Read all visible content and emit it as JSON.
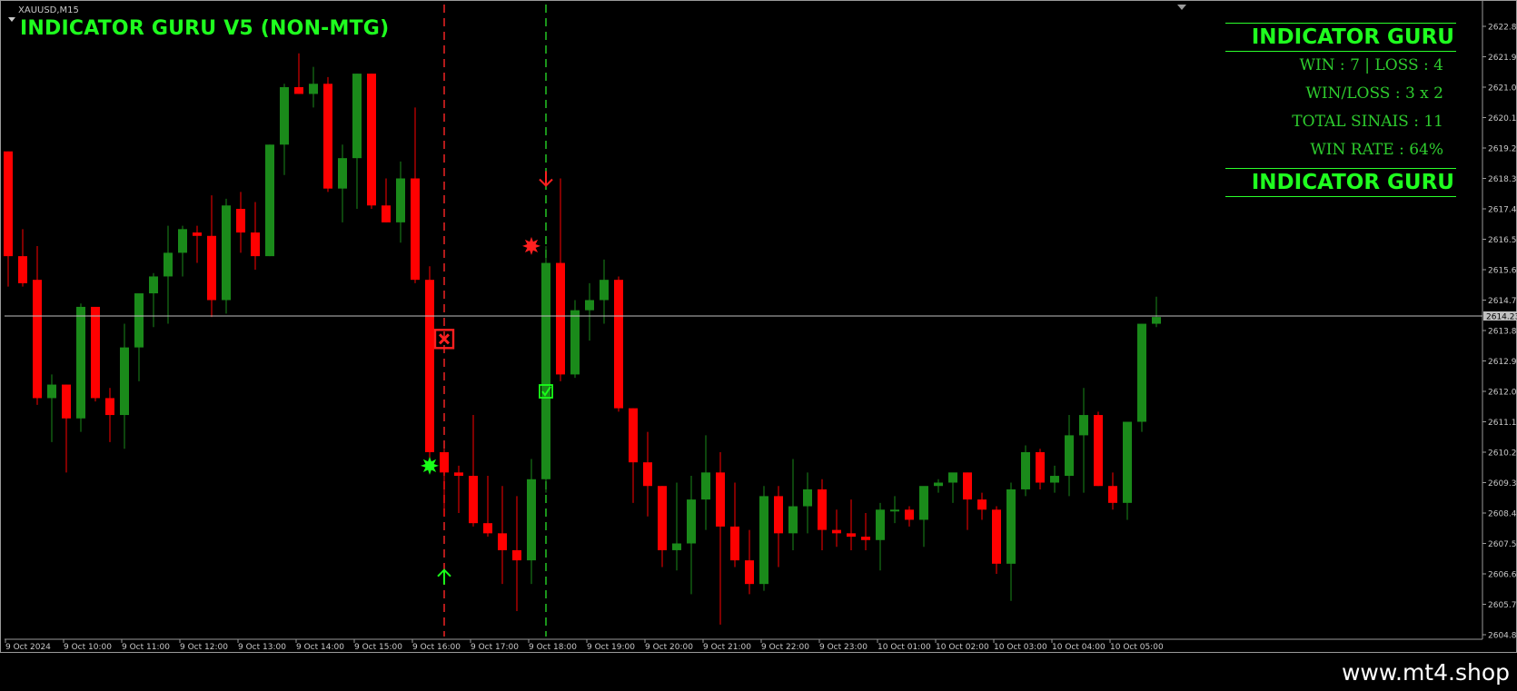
{
  "window": {
    "symbol_label": "XAUUSD,M15",
    "indicator_title": "INDICATOR GURU V5 (NON-MTG)"
  },
  "stats_panel": {
    "header_top": "INDICATOR GURU",
    "win_loss": "WIN : 7 | LOSS : 4",
    "win_loss_ratio": "WIN/LOSS : 3 x 2",
    "total_signals": "TOTAL SINAIS : 11",
    "win_rate": "WIN RATE : 64%",
    "header_bottom": "INDICATOR GURU"
  },
  "branding": {
    "site": "www.mt4.shop"
  },
  "colors": {
    "bull": "#1a8a1a",
    "bear": "#ff0000",
    "text_green": "#1fff1f",
    "axis_text": "#c8c8c8",
    "price_line": "#c0c0c0"
  },
  "chart_data": {
    "type": "candlestick",
    "title": "",
    "ylim": [
      2604.8,
      2622.8
    ],
    "y_ticks": [
      "2622.80",
      "2621.90",
      "2621.00",
      "2620.10",
      "2619.20",
      "2618.30",
      "2617.40",
      "2616.50",
      "2615.60",
      "2614.70",
      "2613.80",
      "2612.90",
      "2612.00",
      "2611.10",
      "2610.20",
      "2609.30",
      "2608.40",
      "2607.50",
      "2606.60",
      "2605.70",
      "2604.80"
    ],
    "x_labels": [
      "9 Oct 2024",
      "9 Oct 10:00",
      "9 Oct 11:00",
      "9 Oct 12:00",
      "9 Oct 13:00",
      "9 Oct 14:00",
      "9 Oct 15:00",
      "9 Oct 16:00",
      "9 Oct 17:00",
      "9 Oct 18:00",
      "9 Oct 19:00",
      "9 Oct 20:00",
      "9 Oct 21:00",
      "9 Oct 22:00",
      "9 Oct 23:00",
      "10 Oct 01:00",
      "10 Oct 02:00",
      "10 Oct 03:00",
      "10 Oct 04:00",
      "10 Oct 05:00"
    ],
    "current_price": 2614.23,
    "current_price_label": "2614.23",
    "candles": [
      [
        2619.1,
        2619.1,
        2615.1,
        2616.0
      ],
      [
        2616.0,
        2616.8,
        2615.1,
        2615.2
      ],
      [
        2615.3,
        2616.3,
        2611.6,
        2611.8
      ],
      [
        2611.8,
        2612.5,
        2610.5,
        2612.2
      ],
      [
        2612.2,
        2612.2,
        2609.6,
        2611.2
      ],
      [
        2611.2,
        2614.6,
        2610.8,
        2614.5
      ],
      [
        2614.5,
        2614.5,
        2611.7,
        2611.8
      ],
      [
        2611.8,
        2612.1,
        2610.5,
        2611.3
      ],
      [
        2611.3,
        2614.0,
        2610.3,
        2613.3
      ],
      [
        2613.3,
        2614.8,
        2612.3,
        2614.9
      ],
      [
        2614.9,
        2615.5,
        2613.9,
        2615.4
      ],
      [
        2615.4,
        2616.9,
        2614.0,
        2616.1
      ],
      [
        2616.1,
        2616.9,
        2615.4,
        2616.8
      ],
      [
        2616.7,
        2616.9,
        2615.8,
        2616.6
      ],
      [
        2616.6,
        2617.8,
        2614.2,
        2614.7
      ],
      [
        2614.7,
        2617.7,
        2614.3,
        2617.5
      ],
      [
        2617.4,
        2617.9,
        2616.1,
        2616.7
      ],
      [
        2616.7,
        2617.6,
        2615.6,
        2616.0
      ],
      [
        2616.0,
        2619.3,
        2616.0,
        2619.3
      ],
      [
        2619.3,
        2621.1,
        2618.4,
        2621.0
      ],
      [
        2621.0,
        2622.0,
        2620.8,
        2620.8
      ],
      [
        2620.8,
        2621.6,
        2620.4,
        2621.1
      ],
      [
        2621.1,
        2621.3,
        2617.9,
        2618.0
      ],
      [
        2618.0,
        2619.3,
        2617.0,
        2618.9
      ],
      [
        2618.9,
        2621.4,
        2617.4,
        2621.4
      ],
      [
        2621.4,
        2621.4,
        2617.4,
        2617.5
      ],
      [
        2617.5,
        2618.3,
        2617.0,
        2617.0
      ],
      [
        2617.0,
        2618.8,
        2616.4,
        2618.3
      ],
      [
        2618.3,
        2620.4,
        2615.2,
        2615.3
      ],
      [
        2615.3,
        2615.7,
        2609.8,
        2610.2
      ],
      [
        2610.2,
        2610.3,
        2608.3,
        2609.6
      ],
      [
        2609.6,
        2609.8,
        2608.4,
        2609.5
      ],
      [
        2609.5,
        2611.3,
        2608.0,
        2608.1
      ],
      [
        2608.1,
        2609.5,
        2607.7,
        2607.8
      ],
      [
        2607.8,
        2609.2,
        2606.3,
        2607.3
      ],
      [
        2607.3,
        2608.9,
        2605.5,
        2607.0
      ],
      [
        2607.0,
        2610.0,
        2606.3,
        2609.4
      ],
      [
        2609.4,
        2616.3,
        2609.0,
        2615.8
      ],
      [
        2615.8,
        2618.3,
        2612.3,
        2612.5
      ],
      [
        2612.5,
        2614.7,
        2612.4,
        2614.4
      ],
      [
        2614.4,
        2615.2,
        2613.5,
        2614.7
      ],
      [
        2614.7,
        2615.9,
        2614.0,
        2615.3
      ],
      [
        2615.3,
        2615.4,
        2611.4,
        2611.5
      ],
      [
        2611.5,
        2611.5,
        2608.7,
        2609.9
      ],
      [
        2609.9,
        2610.8,
        2608.3,
        2609.2
      ],
      [
        2609.2,
        2609.2,
        2606.8,
        2607.3
      ],
      [
        2607.3,
        2609.3,
        2606.7,
        2607.5
      ],
      [
        2607.5,
        2609.5,
        2606.0,
        2608.8
      ],
      [
        2608.8,
        2610.7,
        2607.9,
        2609.6
      ],
      [
        2609.6,
        2610.2,
        2605.1,
        2608.0
      ],
      [
        2608.0,
        2609.3,
        2606.8,
        2607.0
      ],
      [
        2607.0,
        2607.9,
        2606.0,
        2606.3
      ],
      [
        2606.3,
        2609.2,
        2606.1,
        2608.9
      ],
      [
        2608.9,
        2609.2,
        2606.8,
        2607.8
      ],
      [
        2607.8,
        2610.0,
        2607.3,
        2608.6
      ],
      [
        2608.6,
        2609.6,
        2607.8,
        2609.1
      ],
      [
        2609.1,
        2609.4,
        2607.3,
        2607.9
      ],
      [
        2607.9,
        2608.5,
        2607.4,
        2607.8
      ],
      [
        2607.8,
        2608.8,
        2607.3,
        2607.7
      ],
      [
        2607.7,
        2608.4,
        2607.3,
        2607.6
      ],
      [
        2607.6,
        2608.7,
        2606.7,
        2608.5
      ],
      [
        2608.5,
        2608.9,
        2608.1,
        2608.5
      ],
      [
        2608.5,
        2608.6,
        2608.0,
        2608.2
      ],
      [
        2608.2,
        2608.9,
        2607.4,
        2609.2
      ],
      [
        2609.2,
        2609.4,
        2609.0,
        2609.3
      ],
      [
        2609.3,
        2609.5,
        2608.7,
        2609.6
      ],
      [
        2609.6,
        2609.6,
        2607.9,
        2608.8
      ],
      [
        2608.8,
        2609.0,
        2608.2,
        2608.5
      ],
      [
        2608.5,
        2608.6,
        2606.6,
        2606.9
      ],
      [
        2606.9,
        2609.3,
        2605.8,
        2609.1
      ],
      [
        2609.1,
        2610.4,
        2608.9,
        2610.2
      ],
      [
        2610.2,
        2610.3,
        2609.1,
        2609.3
      ],
      [
        2609.3,
        2609.8,
        2609.0,
        2609.5
      ],
      [
        2609.5,
        2611.3,
        2608.9,
        2610.7
      ],
      [
        2610.7,
        2612.1,
        2609.0,
        2611.3
      ],
      [
        2611.3,
        2611.4,
        2609.2,
        2609.2
      ],
      [
        2609.2,
        2609.6,
        2608.5,
        2608.7
      ],
      [
        2608.7,
        2611.0,
        2608.2,
        2611.1
      ],
      [
        2611.1,
        2614.0,
        2610.8,
        2614.0
      ],
      [
        2614.0,
        2614.8,
        2613.9,
        2614.2
      ]
    ],
    "vertical_markers": [
      {
        "candle": 30,
        "color": "#e02020"
      },
      {
        "candle": 37,
        "color": "#22b822"
      }
    ],
    "signals": [
      {
        "candle": 30,
        "type": "x-box",
        "price": 2613.55,
        "color": "#ff2020"
      },
      {
        "candle": 29,
        "type": "star",
        "price": 2609.8,
        "color": "#19ff19"
      },
      {
        "candle": 30,
        "type": "up-arrow",
        "price": 2606.5,
        "color": "#19ff19"
      },
      {
        "candle": 36,
        "type": "star",
        "price": 2616.3,
        "color": "#ff2020"
      },
      {
        "candle": 37,
        "type": "down-arrow",
        "price": 2618.3,
        "color": "#ff2020"
      },
      {
        "candle": 37,
        "type": "check-box",
        "price": 2612.0,
        "color": "#19ff19"
      }
    ]
  }
}
